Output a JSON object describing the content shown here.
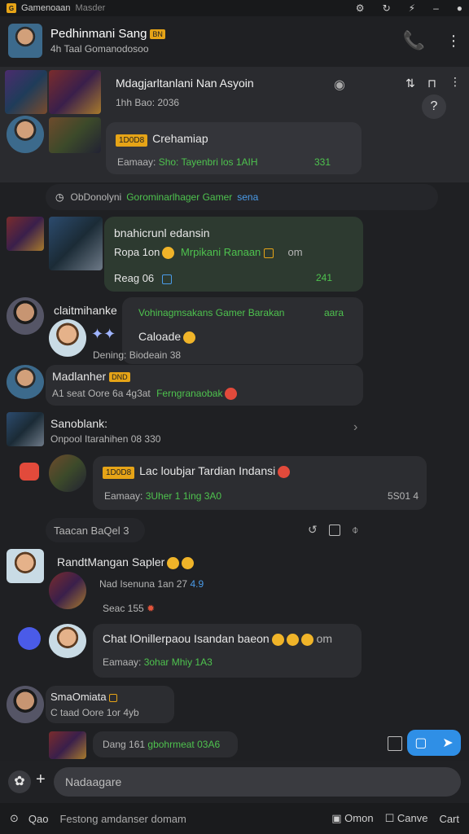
{
  "statusbar": {
    "app": "Gamenoaan",
    "sub": "Masder"
  },
  "header": {
    "name": "Pedhinmani Sang",
    "tag": "BN",
    "sub": "4h Taal Gomanodosoo"
  },
  "pinned": {
    "title": "Mdagjarltanlani Nan Asyoin",
    "meta": "1hh Bao: 2036",
    "card_tag": "1D0D8",
    "card_title": "Crehamiap",
    "card_label": "Eamaay:",
    "card_line": "Sho: Tayenbri los 1AIH",
    "card_count": "331"
  },
  "system_notice": {
    "prefix": "ObDonolyni",
    "text": "Gorominarlhager Gamer",
    "link": "sena"
  },
  "msg1": {
    "title": "bnahicrunl edansin",
    "line1": "Ropa 1on",
    "line1_green": "Mrpikani Ranaan",
    "line1_tail": "om",
    "line2": "Reag 06",
    "count": "241"
  },
  "msg2": {
    "name": "claitmihanke",
    "header_green": "Vohinagmsakans Gamer Barakan",
    "header_tail": "aara",
    "line1": "Caloade",
    "line2": "Dening: Biodeain 38"
  },
  "msg3": {
    "name": "Madlanher",
    "tag": "DND",
    "line": "A1 seat Oore 6a 4g3at",
    "line_green": "Ferngranaobak"
  },
  "msg4": {
    "name": "Sanoblank:",
    "line": "Onpool Itarahihen 08 330"
  },
  "msg5": {
    "tag": "1D0D8",
    "title": "Lac loubjar Tardian Indansi",
    "label": "Eamaay:",
    "line_green": "3Uher 1 1ing 3A0",
    "count": "5S01 4"
  },
  "section": {
    "label": "Taacan BaQel 3"
  },
  "msg6": {
    "title": "RandtMangan Sapler",
    "line1": "Nad Isenuna 1an 27",
    "line1_blue": "4.9",
    "line2": "Seac 155"
  },
  "msg7": {
    "title": "Chat lOnillerpaou Isandan baeon",
    "tail": "om",
    "label": "Eamaay:",
    "line_green": "3ohar Mhiy 1A3"
  },
  "msg8": {
    "name": "SmaOmiata",
    "line": "C taad Oore 1or 4yb"
  },
  "msg9": {
    "line": "Dang 161",
    "line_green": "gbohrmeat 03A6"
  },
  "composer": {
    "placeholder": "Nadaagare"
  },
  "bottombar": {
    "left_icon": "Qao",
    "left": "Festong amdanser domam",
    "btn1": "Omon",
    "btn2": "Canve",
    "btn3": "Cart"
  },
  "colors": {
    "accent_blue": "#2f8fe6",
    "green": "#4ec24e",
    "badge": "#e6a417"
  }
}
